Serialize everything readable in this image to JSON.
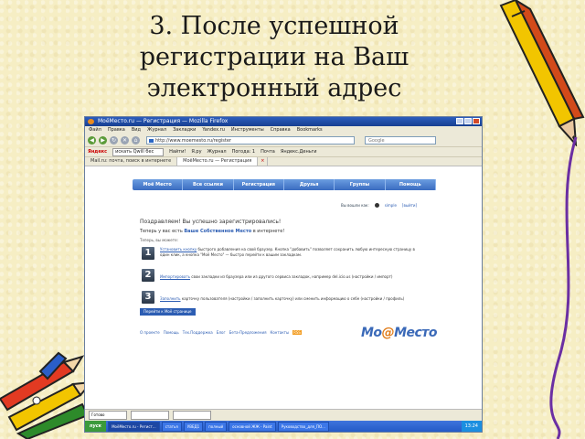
{
  "slide": {
    "title_lines": [
      "3. После успешной",
      "регистрации на Ваш",
      "электронный адрес"
    ]
  },
  "browser": {
    "window_title": "МоёМесто.ru — Регистрация — Mozilla Firefox",
    "menu": [
      "Файл",
      "Правка",
      "Вид",
      "Журнал",
      "Закладки",
      "Yandex.ru",
      "Инструменты",
      "Справка",
      "Bookmarks"
    ],
    "url": "http://www.moemesto.ru/register",
    "search_placeholder": "Google",
    "yandex_bar": {
      "logo": "Яндекс",
      "field": "искать Qwill бес",
      "items": [
        "Найти!",
        "Я.ру",
        "Журнал",
        "Погода: 1",
        "Почта",
        "Яндекс.Деньги"
      ]
    },
    "tabs": [
      "Mail.ru: почта, поиск в интернете",
      "МоёМесто.ru — Регистрация"
    ],
    "statusbar": [
      "Готово",
      "",
      ""
    ]
  },
  "site": {
    "nav": [
      "Моё Место",
      "Все ссылки",
      "Регистрация",
      "Друзья",
      "Группы",
      "Помощь"
    ],
    "login_prefix": "Вы вошли как:",
    "login_user": "simple",
    "logout": "[выйти]",
    "congrats": "Поздравляем! Вы успешно зарегистрировались!",
    "now_line_prefix": "Теперь у вас есть",
    "now_line_link": "Ваше Собственное Место",
    "now_line_suffix": "в интернете!",
    "you_can": "Теперь, вы можете:",
    "steps": [
      {
        "num": "1",
        "link": "Установить кнопку",
        "text": " быстрого добавления на свой браузер. Кнопка \"добавить\" позволяет сохранить любую интересную страницу в один клик, а кнопка \"Моё Место\" — быстро перейти к вашим закладкам."
      },
      {
        "num": "2",
        "link": "Импортировать",
        "text": " свои закладки из браузера или из другого сервиса закладок, например del.icio.us (настройки / импорт)"
      },
      {
        "num": "3",
        "link": "Заполнить",
        "text": " карточку пользователя (настройки / заполнить карточку) или сменить информацию о себе (настройки / профиль)"
      }
    ],
    "go_button": "Перейти к Моё странице",
    "footer_links": [
      "О проекте",
      "Помощь",
      "Тех.Поддержка",
      "Блог",
      "Бета-Предложения",
      "Контакты"
    ],
    "rss": "RSS",
    "logo_text_a": "Мо",
    "logo_text_at": "@",
    "logo_text_b": "Место"
  },
  "taskbar": {
    "start": "пуск",
    "items": [
      "МоёМесто.ru - Регист...",
      "статья",
      "УВЕД1",
      "полный",
      "основной ЖЖ - Paint",
      "Руководство_для_ПО..."
    ],
    "clock": "13:24"
  },
  "colors": {
    "accent": "#2c5db3",
    "slide_bg": "#f6eec4",
    "nav": "#4a7ed0"
  }
}
